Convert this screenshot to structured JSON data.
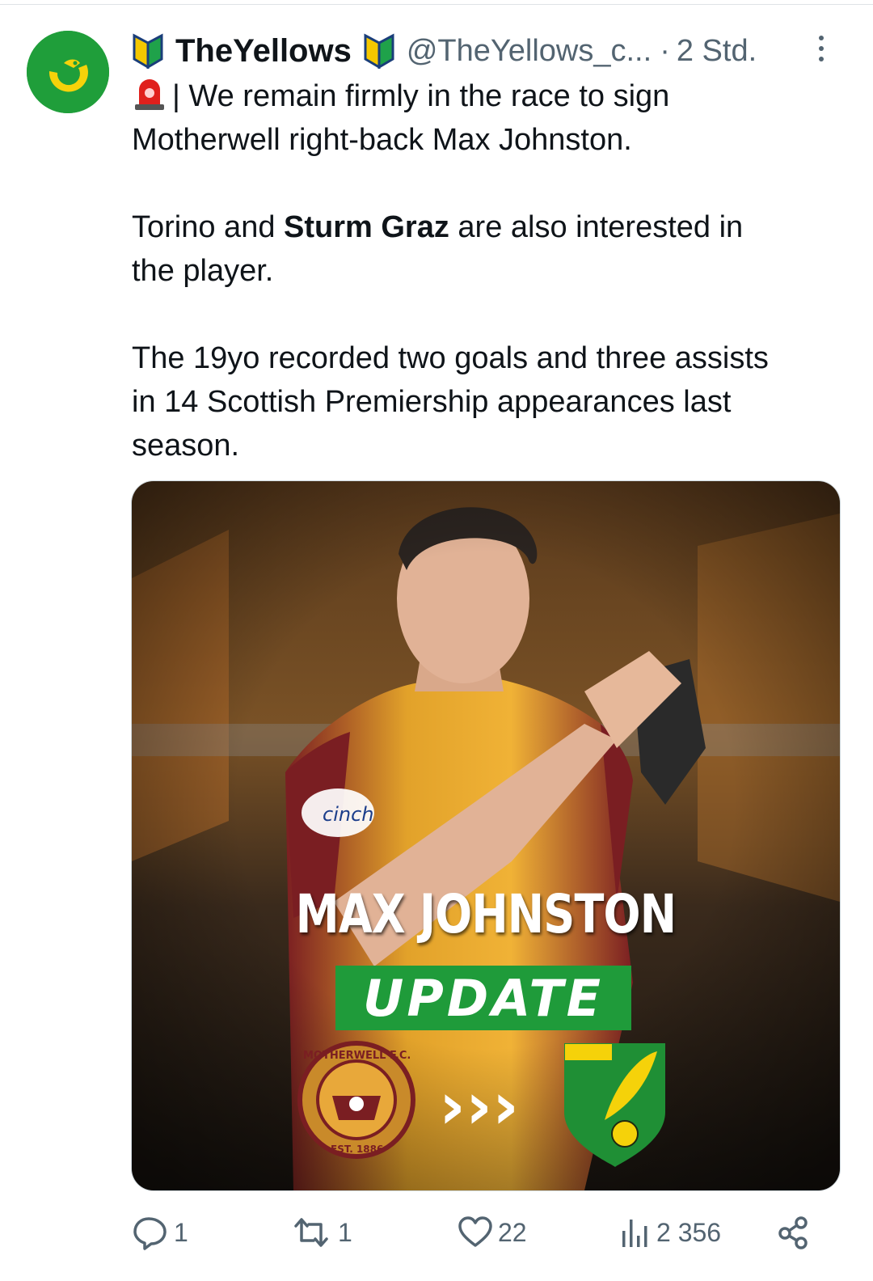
{
  "tweet": {
    "display_name": "TheYellows",
    "handle": "@TheYellows_c...",
    "separator": "·",
    "time": "2 Std.",
    "line1": "| We remain firmly in the race to sign",
    "line2": "Motherwell right-back Max Johnston.",
    "p2_a": "Torino and ",
    "p2_bold": "Sturm Graz",
    "p2_b": " are also interested in",
    "p2_line2": "the player.",
    "p3_line1": "The 19yo recorded two goals and three assists",
    "p3_line2": "in 14 Scottish Premiership appearances last",
    "p3_line3": "season."
  },
  "media": {
    "player_name": "MAX JOHNSTON",
    "banner": "UPDATE",
    "sponsor": "cinch",
    "from_crest_text": "MOTHERWELL F.C.",
    "from_crest_est": "EST. 1886",
    "arrows": "›››"
  },
  "actions": {
    "replies": "1",
    "reposts": "1",
    "likes": "22",
    "views": "2 356"
  },
  "colors": {
    "accent_green": "#1f9b3a",
    "canary_yellow": "#f5d20a",
    "muted_text": "#536471"
  }
}
